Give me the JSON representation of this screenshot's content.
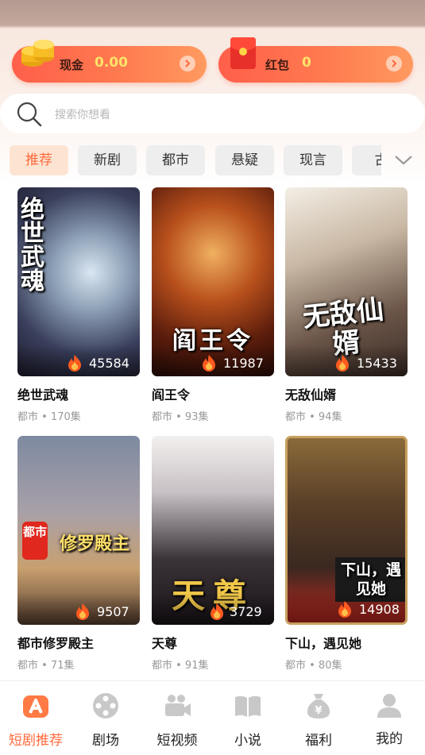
{
  "wallet": {
    "cash_label": "现金",
    "cash_value": "0.00",
    "redpack_label": "红包",
    "redpack_value": "0"
  },
  "search": {
    "placeholder": "搜索你想看"
  },
  "tabs": [
    {
      "label": "推荐",
      "active": true
    },
    {
      "label": "新剧"
    },
    {
      "label": "都市"
    },
    {
      "label": "悬疑"
    },
    {
      "label": "现言"
    },
    {
      "label": "古"
    }
  ],
  "dramas": [
    {
      "title": "绝世武魂",
      "meta": "都市 • 170集",
      "views": "45584",
      "poster_text": "绝世武魂"
    },
    {
      "title": "阎王令",
      "meta": "都市 • 93集",
      "views": "11987",
      "poster_text": "阎王令"
    },
    {
      "title": "无敌仙婿",
      "meta": "都市 • 94集",
      "views": "15433",
      "poster_text": "无敌仙婿"
    },
    {
      "title": "都市修罗殿主",
      "meta": "都市 • 71集",
      "views": "9507",
      "poster_text": "修罗殿主",
      "badge": "都市"
    },
    {
      "title": "天尊",
      "meta": "都市 • 91集",
      "views": "3729",
      "poster_text": "天尊"
    },
    {
      "title": "下山，遇见她",
      "meta": "都市 • 80集",
      "views": "14908",
      "poster_text": "下山，遇见她"
    }
  ],
  "nav": [
    {
      "label": "短剧推荐",
      "icon": "drama-icon",
      "active": true
    },
    {
      "label": "剧场",
      "icon": "theater-icon"
    },
    {
      "label": "短视频",
      "icon": "video-camera-icon"
    },
    {
      "label": "小说",
      "icon": "book-icon"
    },
    {
      "label": "福利",
      "icon": "money-bag-icon"
    },
    {
      "label": "我的",
      "icon": "user-icon"
    }
  ],
  "colors": {
    "accent": "#ff6a3c",
    "wallet_value": "#ffe36a"
  }
}
